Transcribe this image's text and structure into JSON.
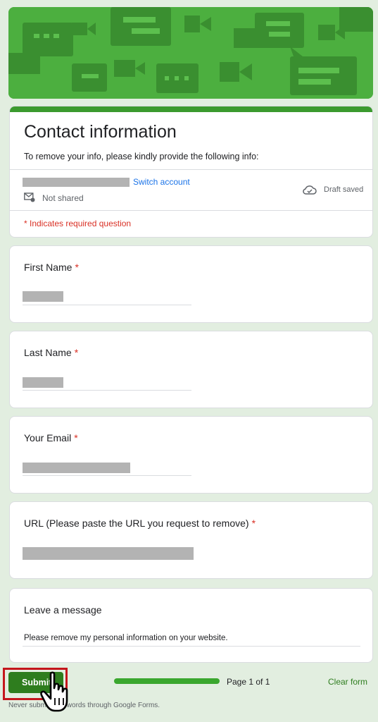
{
  "header": {
    "title": "Contact information",
    "description": "To remove your info, please kindly provide the following info:",
    "switch_account": "Switch account",
    "not_shared": "Not shared",
    "draft_saved": "Draft saved",
    "required_note": "* Indicates required question"
  },
  "questions": [
    {
      "label": "First Name",
      "required": "*"
    },
    {
      "label": "Last Name",
      "required": "*"
    },
    {
      "label": "Your Email",
      "required": "*"
    },
    {
      "label": "URL (Please paste the URL you request to remove)",
      "required": "*"
    }
  ],
  "message": {
    "label": "Leave a message",
    "value": "Please remove my personal information on your website."
  },
  "footer": {
    "submit": "Submit",
    "page_indicator": "Page 1 of 1",
    "clear_form": "Clear form",
    "warning": "Never submit passwords through Google Forms.",
    "progress": 1.0
  },
  "colors": {
    "banner": "#4caf3f",
    "accent": "#3b9a2e",
    "required": "#d93025",
    "link": "#1a73e8",
    "submit_bg": "#2e7d1e",
    "highlight_box": "#c4161c"
  },
  "icons": [
    "mail-shield-icon",
    "cloud-check-icon",
    "pointer-hand-icon"
  ]
}
